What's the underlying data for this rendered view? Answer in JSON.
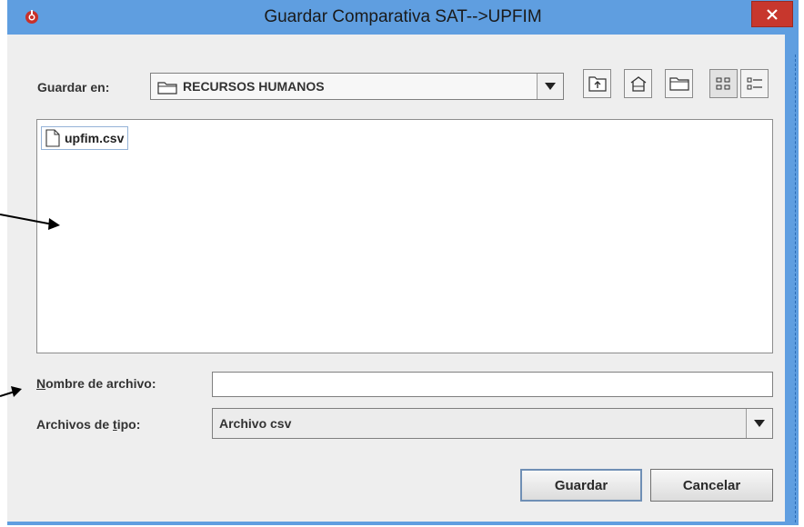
{
  "window": {
    "title": "Guardar Comparativa SAT-->UPFIM",
    "title_bar_color": "#5f9ee0",
    "close_color": "#c7372d"
  },
  "toolbar": {
    "look_in_label": "Guardar en:",
    "current_folder": "RECURSOS HUMANOS",
    "buttons": [
      "up-one-level-icon",
      "home-icon",
      "new-folder-icon",
      "list-view-icon",
      "details-view-icon"
    ]
  },
  "file_list": {
    "items": [
      {
        "name": "upfim.csv",
        "icon": "file-icon"
      }
    ]
  },
  "file_name": {
    "label_mnemonic": "N",
    "label_rest": "ombre de archivo:",
    "value": ""
  },
  "file_type": {
    "label_prefix": "Archivos de ",
    "label_mnemonic": "t",
    "label_suffix": "ipo:",
    "value": "Archivo csv"
  },
  "actions": {
    "save_label": "Guardar",
    "cancel_label": "Cancelar"
  }
}
